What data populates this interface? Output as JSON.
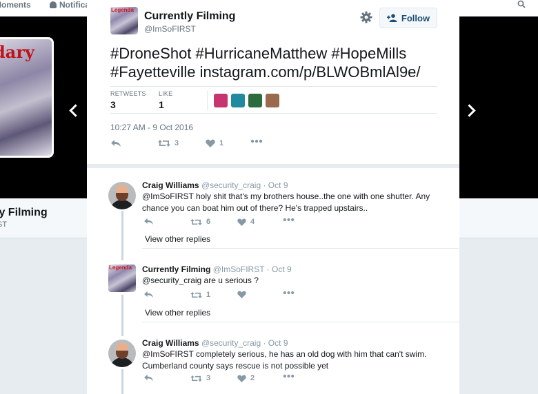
{
  "background": {
    "nav": {
      "moments_label": "Moments",
      "notifications_label": "Notifica"
    },
    "banner_word": "dary",
    "profile_name": "ly Filming",
    "profile_handle": "ST"
  },
  "tweet": {
    "author_name": "Currently Filming",
    "author_handle": "@ImSoFIRST",
    "avatar_text": "Legenda",
    "follow_label": "Follow",
    "text_line1": "#DroneShot #HurricaneMatthew #HopeMills",
    "text_line2": "#Fayetteville instagram.com/p/BLWOBmlAl9e/",
    "retweets_label": "RETWEETS",
    "retweets_count": "3",
    "likes_label": "LIKE",
    "likes_count": "1",
    "timestamp": "10:27 AM - 9 Oct 2016",
    "action_retweet_count": "3",
    "action_like_count": "1",
    "liker_colors": [
      "#c7356f",
      "#1f8aa0",
      "#2c6b3e",
      "#9a6a4c"
    ]
  },
  "replies": [
    {
      "name": "Craig Williams",
      "meta": "@security_craig · Oct 9",
      "text": "@ImSoFIRST holy shit that's my brothers house..the one with one shutter. Any chance you can boat him out of there? He's trapped upstairs..",
      "retweet_count": "6",
      "like_count": "4",
      "view_other_replies": "View other replies"
    },
    {
      "name": "Currently Filming",
      "meta": "@ImSoFIRST · Oct 9",
      "text": "@security_craig are u serious ?",
      "retweet_count": "1",
      "like_count": "",
      "view_other_replies": "View other replies"
    },
    {
      "name": "Craig Williams",
      "meta": "@security_craig · Oct 9",
      "text": "@ImSoFIRST completely serious, he has an old dog with him that can't swim. Cumberland county says rescue is not possible yet",
      "retweet_count": "3",
      "like_count": "2"
    }
  ],
  "colors": {
    "text_primary": "#14171a",
    "text_secondary": "#66757f",
    "icon_gray": "#8899a6",
    "follow_text": "#1d4d74",
    "divider": "#e1e8ed",
    "backdrop": "#000000"
  }
}
